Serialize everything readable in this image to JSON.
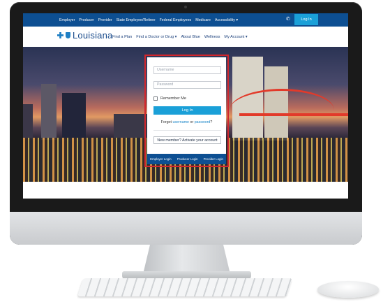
{
  "topnav": {
    "links": [
      "Employer",
      "Producer",
      "Provider",
      "State Employee/Retiree",
      "Federal Employees",
      "Medicare",
      "Accessibility ▾"
    ],
    "login": "Log In",
    "phone_icon": "phone-icon"
  },
  "header": {
    "brand": "Louisiana",
    "nav": [
      "Find a Plan",
      "Find a Doctor or Drug ▾",
      "About Blue",
      "Wellness",
      "My Account ▾"
    ]
  },
  "login_card": {
    "username_placeholder": "Username",
    "password_placeholder": "Password",
    "remember_label": "Remember Me",
    "login_button": "Log In",
    "forgot_prefix": "Forgot",
    "forgot_username": "username",
    "forgot_or": "or",
    "forgot_password": "password",
    "forgot_suffix": "?",
    "new_member_button": "New member? Activate your account",
    "footer_links": [
      "Employer Login",
      "Producer Login",
      "Provider Login"
    ]
  },
  "colors": {
    "nav_blue": "#0d4f92",
    "accent_blue": "#1aa0d8",
    "highlight_red": "#d2262c"
  }
}
